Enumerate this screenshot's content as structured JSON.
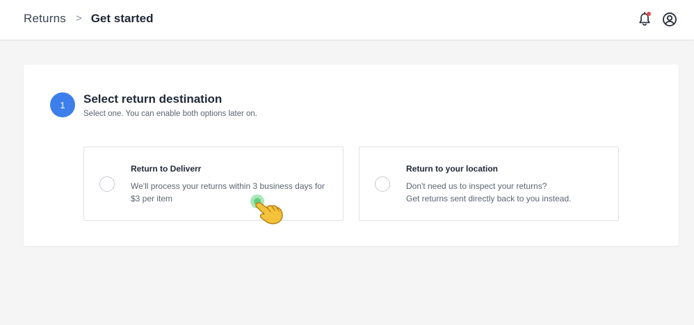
{
  "header": {
    "breadcrumb_root": "Returns",
    "breadcrumb_separator": ">",
    "breadcrumb_current": "Get started"
  },
  "step": {
    "number": "1",
    "title": "Select return destination",
    "subtitle": "Select one. You can enable both options later on."
  },
  "options": [
    {
      "title": "Return to Deliverr",
      "description": "We'll process your returns within 3 business days for $3 per item",
      "selected": false
    },
    {
      "title": "Return to your location",
      "description_line1": "Don't need us to inspect your returns?",
      "description_line2": "Get returns sent directly back to you instead.",
      "selected": false
    }
  ],
  "icons": {
    "notifications": "bell-icon",
    "account": "user-circle-icon",
    "pointer": "pointing-hand-icon"
  },
  "colors": {
    "accent": "#3d7fea",
    "notification_dot": "#e5484d",
    "click_highlight": "#6fd98a",
    "background": "#f5f5f6"
  }
}
